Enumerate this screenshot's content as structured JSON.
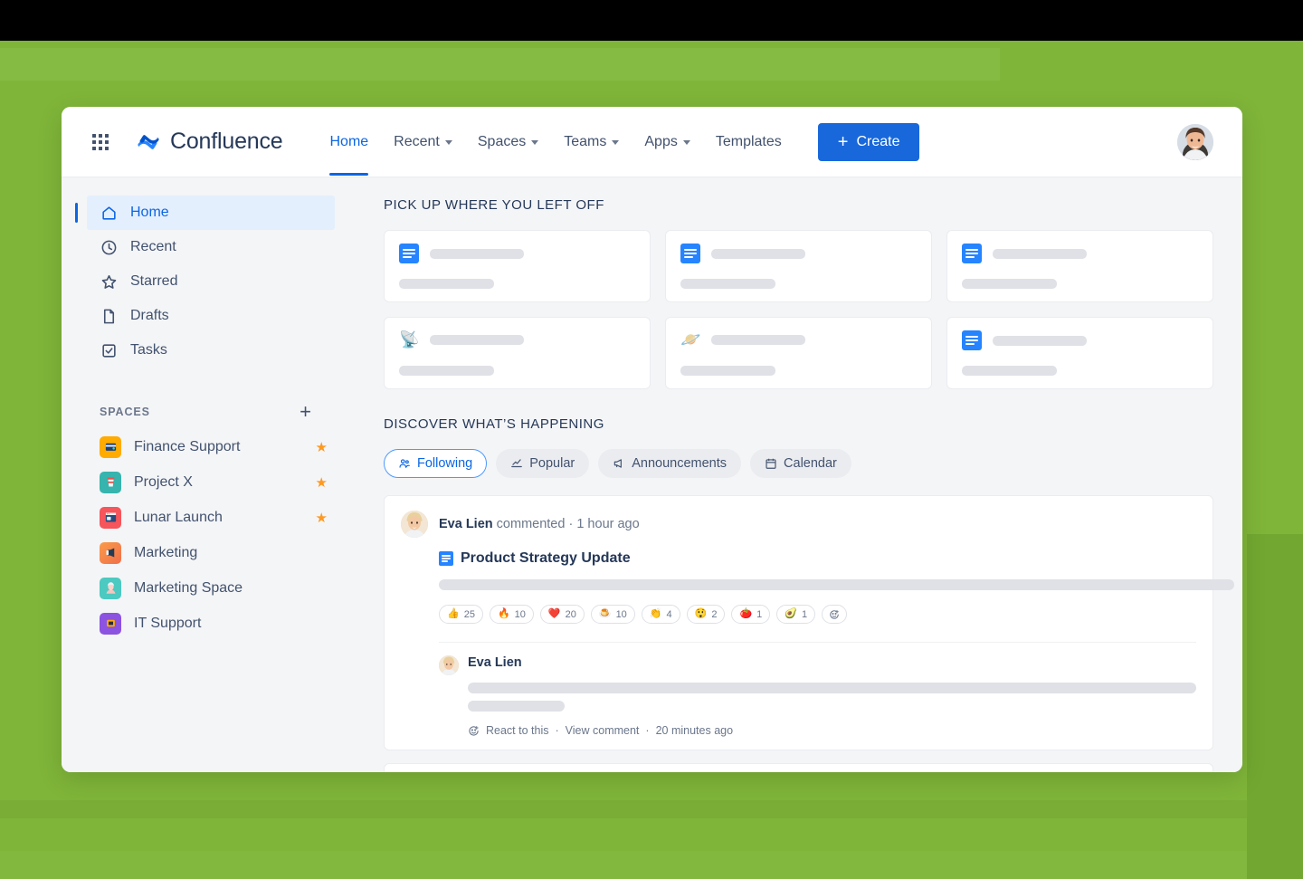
{
  "brand": {
    "name": "Confluence",
    "app_switcher_icon": "grid-menu-icon",
    "logo_icon": "confluence-logo-icon"
  },
  "topnav": {
    "links": [
      {
        "label": "Home",
        "active": true,
        "has_caret": false
      },
      {
        "label": "Recent",
        "active": false,
        "has_caret": true
      },
      {
        "label": "Spaces",
        "active": false,
        "has_caret": true
      },
      {
        "label": "Teams",
        "active": false,
        "has_caret": true
      },
      {
        "label": "Apps",
        "active": false,
        "has_caret": true
      },
      {
        "label": "Templates",
        "active": false,
        "has_caret": false
      }
    ],
    "create_label": "Create",
    "create_icon": "plus-icon",
    "create_color": "#1868db",
    "avatar_icon": "user-avatar"
  },
  "sidebar": {
    "items": [
      {
        "label": "Home",
        "icon": "home-icon",
        "active": true
      },
      {
        "label": "Recent",
        "icon": "clock-icon",
        "active": false
      },
      {
        "label": "Starred",
        "icon": "star-outline-icon",
        "active": false
      },
      {
        "label": "Drafts",
        "icon": "page-icon",
        "active": false
      },
      {
        "label": "Tasks",
        "icon": "checkbox-icon",
        "active": false
      }
    ],
    "spaces_heading": "SPACES",
    "spaces_add_icon": "plus-icon",
    "spaces": [
      {
        "label": "Finance Support",
        "starred": true,
        "icon": "wallet-icon",
        "color": "#ffab00",
        "glyph": "💼"
      },
      {
        "label": "Project X",
        "starred": true,
        "icon": "coffee-cup-icon",
        "color": "#36b4ad",
        "glyph": "🥤"
      },
      {
        "label": "Lunar Launch",
        "starred": true,
        "icon": "browser-window-icon",
        "color": "#f5555b",
        "glyph": "🗔"
      },
      {
        "label": "Marketing",
        "starred": false,
        "icon": "megaphone-icon",
        "color": "#fa8042",
        "glyph": "🔈"
      },
      {
        "label": "Marketing Space",
        "starred": false,
        "icon": "person-icon",
        "color": "#4cc9c0",
        "glyph": "👤"
      },
      {
        "label": "IT Support",
        "starred": false,
        "icon": "support-icon",
        "color": "#8c52e0",
        "glyph": "🔧"
      }
    ],
    "star_color": "#ff991f",
    "active_color": "#0c66e4"
  },
  "main": {
    "pickup_title": "PICK UP WHERE YOU LEFT OFF",
    "pickup_cards": [
      {
        "icon": "blue-document-icon",
        "icon_type": "doc"
      },
      {
        "icon": "blue-document-icon",
        "icon_type": "doc"
      },
      {
        "icon": "blue-document-icon",
        "icon_type": "doc"
      },
      {
        "icon": "satellite-antenna-emoji",
        "icon_type": "emoji",
        "glyph": "📡"
      },
      {
        "icon": "ringed-planet-emoji",
        "icon_type": "emoji",
        "glyph": "🪐"
      },
      {
        "icon": "blue-document-icon",
        "icon_type": "doc"
      }
    ],
    "discover_title": "DISCOVER WHAT’S HAPPENING",
    "tabs": [
      {
        "label": "Following",
        "icon": "people-icon",
        "active": true
      },
      {
        "label": "Popular",
        "icon": "trending-chart-icon",
        "active": false
      },
      {
        "label": "Announcements",
        "icon": "megaphone-icon",
        "active": false
      },
      {
        "label": "Calendar",
        "icon": "calendar-icon",
        "active": false
      }
    ],
    "feed": [
      {
        "author": "Eva Lien",
        "action": "commented",
        "separator": "·",
        "time": "1 hour ago",
        "page_title": "Product Strategy Update",
        "page_icon": "blue-document-icon",
        "reactions": [
          {
            "emoji": "👍",
            "name": "thumbs-up",
            "count": "25"
          },
          {
            "emoji": "🔥",
            "name": "fire",
            "count": "10"
          },
          {
            "emoji": "❤️",
            "name": "heart",
            "count": "20"
          },
          {
            "emoji": "🍮",
            "name": "custard",
            "count": "10"
          },
          {
            "emoji": "👏",
            "name": "clap",
            "count": "4"
          },
          {
            "emoji": "😲",
            "name": "astonished-face",
            "count": "2"
          },
          {
            "emoji": "🍅",
            "name": "tomato",
            "count": "1"
          },
          {
            "emoji": "🥑",
            "name": "avocado",
            "count": "1"
          }
        ],
        "add_reaction_icon": "add-reaction-icon",
        "comment": {
          "author": "Eva Lien",
          "react_label": "React to this",
          "view_label": "View comment",
          "time": "20 minutes ago",
          "sep1": "·",
          "sep2": "·",
          "react_icon": "smiley-plus-icon"
        }
      }
    ]
  },
  "colors": {
    "green_background": "#7fb539",
    "page_background": "#f4f5f7",
    "accent_blue": "#0c66e4",
    "skeleton_grey": "#dfe1e6"
  }
}
